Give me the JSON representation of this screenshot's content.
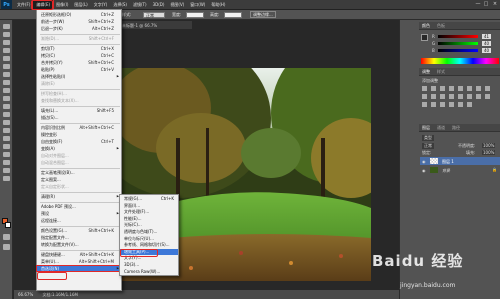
{
  "app": {
    "logo": "Ps"
  },
  "menubar": [
    {
      "label": "文件(F)"
    },
    {
      "label": "编辑(E)",
      "active": true
    },
    {
      "label": "图像(I)"
    },
    {
      "label": "图层(L)"
    },
    {
      "label": "文字(Y)"
    },
    {
      "label": "选择(S)"
    },
    {
      "label": "滤镜(T)"
    },
    {
      "label": "3D(D)"
    },
    {
      "label": "视图(V)"
    },
    {
      "label": "窗口(W)"
    },
    {
      "label": "帮助(H)"
    }
  ],
  "options_bar": {
    "style_label": "样式:",
    "style_value": "正常",
    "width_label": "宽度:",
    "height_label": "高度:",
    "adjust_edge": "调整边缘..."
  },
  "window_controls": {
    "minimize": "—",
    "restore": "□",
    "close": "×"
  },
  "document": {
    "tab": "未标题-1 @ 66.7%",
    "zoom": "66.67%",
    "status": "文档:1.16M/1.16M"
  },
  "edit_menu": [
    {
      "label": "还原矩形选框(O)",
      "shortcut": "Ctrl+Z"
    },
    {
      "label": "前进一步(W)",
      "shortcut": "Shift+Ctrl+Z"
    },
    {
      "label": "后退一步(K)",
      "shortcut": "Alt+Ctrl+Z"
    },
    {
      "sep": true
    },
    {
      "label": "渐隐(D)...",
      "shortcut": "Shift+Ctrl+F",
      "disabled": true
    },
    {
      "sep": true
    },
    {
      "label": "剪切(T)",
      "shortcut": "Ctrl+X"
    },
    {
      "label": "拷贝(C)",
      "shortcut": "Ctrl+C"
    },
    {
      "label": "合并拷贝(Y)",
      "shortcut": "Shift+Ctrl+C"
    },
    {
      "label": "粘贴(P)",
      "shortcut": "Ctrl+V"
    },
    {
      "label": "选择性粘贴(I)",
      "submenu": true
    },
    {
      "label": "清除(E)",
      "disabled": true
    },
    {
      "sep": true
    },
    {
      "label": "拼写检查(H)...",
      "disabled": true
    },
    {
      "label": "查找和替换文本(X)...",
      "disabled": true
    },
    {
      "sep": true
    },
    {
      "label": "填充(L)...",
      "shortcut": "Shift+F5"
    },
    {
      "label": "描边(S)..."
    },
    {
      "sep": true
    },
    {
      "label": "内容识别比例",
      "shortcut": "Alt+Shift+Ctrl+C"
    },
    {
      "label": "操控变形"
    },
    {
      "label": "自由变换(F)",
      "shortcut": "Ctrl+T"
    },
    {
      "label": "变换(A)",
      "submenu": true
    },
    {
      "label": "自动对齐图层...",
      "disabled": true
    },
    {
      "label": "自动混合图层...",
      "disabled": true
    },
    {
      "sep": true
    },
    {
      "label": "定义画笔预设(B)..."
    },
    {
      "label": "定义图案..."
    },
    {
      "label": "定义自定形状...",
      "disabled": true
    },
    {
      "sep": true
    },
    {
      "label": "清理(R)",
      "submenu": true
    },
    {
      "sep": true
    },
    {
      "label": "Adobe PDF 预设..."
    },
    {
      "label": "预设",
      "submenu": true
    },
    {
      "label": "远程连接..."
    },
    {
      "sep": true
    },
    {
      "label": "颜色设置(G)...",
      "shortcut": "Shift+Ctrl+K"
    },
    {
      "label": "指定配置文件..."
    },
    {
      "label": "转换为配置文件(V)..."
    },
    {
      "sep": true
    },
    {
      "label": "键盘快捷键...",
      "shortcut": "Alt+Shift+Ctrl+K"
    },
    {
      "label": "菜单(U)...",
      "shortcut": "Alt+Shift+Ctrl+M"
    },
    {
      "label": "首选项(N)",
      "submenu": true,
      "highlight": true
    }
  ],
  "prefs_submenu": [
    {
      "label": "常规(G)...",
      "shortcut": "Ctrl+K"
    },
    {
      "label": "界面(I)..."
    },
    {
      "label": "文件处理(F)..."
    },
    {
      "label": "性能(E)..."
    },
    {
      "label": "光标(C)..."
    },
    {
      "label": "透明度与色域(T)..."
    },
    {
      "label": "单位与标尺(U)..."
    },
    {
      "label": "参考线、网格和切片(S)..."
    },
    {
      "label": "增效工具(P)...",
      "highlight": true
    },
    {
      "label": "文字(Y)..."
    },
    {
      "label": "3D(3)..."
    },
    {
      "label": "Camera Raw(W)..."
    }
  ],
  "panels": {
    "color_tab": "颜色",
    "swatches_tab": "色板",
    "adjust_tab": "调整",
    "styles_tab": "样式",
    "adjust_hint": "添加调整",
    "layers_tab": "图层",
    "channels_tab": "通道",
    "paths_tab": "路径",
    "layers_kind": "类型",
    "blend_mode": "正常",
    "opacity_label": "不透明度:",
    "opacity_value": "100%",
    "lock_label": "锁定:",
    "fill_label": "填充:",
    "fill_value": "100%",
    "layer1_name": "图层 1",
    "bg_name": "背景",
    "r_label": "R",
    "g_label": "G",
    "b_label": "B",
    "r_value": "41",
    "g_value": "40",
    "b_value": "40"
  },
  "watermark": {
    "brand": "Baidu 经验",
    "url": "jingyan.baidu.com"
  },
  "colors": {
    "accent": "#3d78d8",
    "highlight_border": "#e02828",
    "fg_swatch": "#e8612a",
    "bg_swatch": "#ffffff"
  }
}
